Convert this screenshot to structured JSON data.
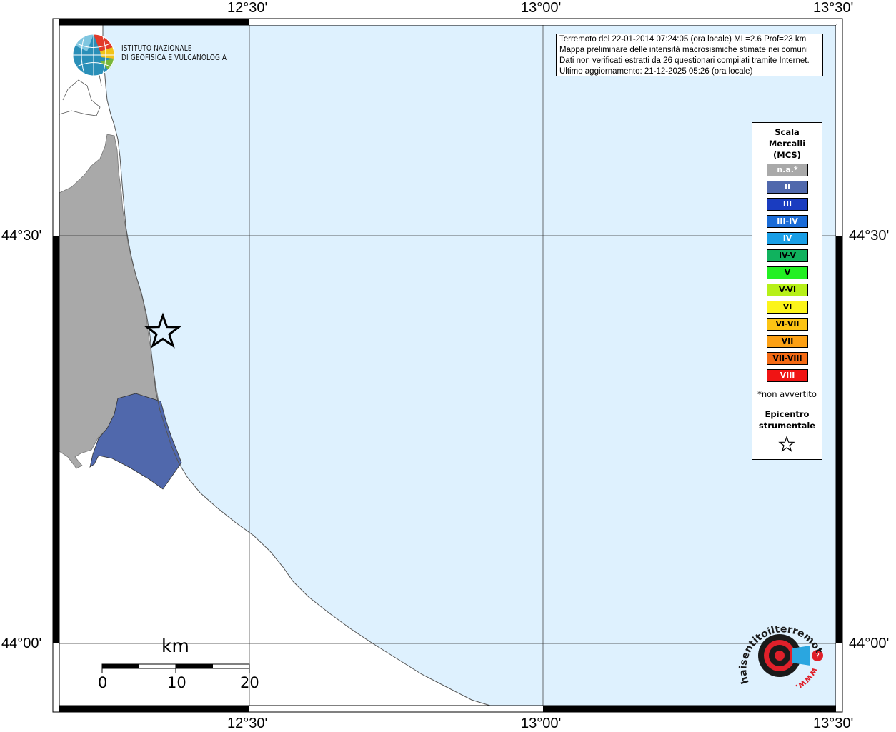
{
  "ticks": {
    "top": [
      "12°30'",
      "13°00'",
      "13°30'"
    ],
    "bottom": [
      "12°30'",
      "13°00'",
      "13°30'"
    ],
    "left": [
      "44°30'",
      "44°00'"
    ],
    "right": [
      "44°30'",
      "44°00'"
    ]
  },
  "info": {
    "line1": "Terremoto del 22-01-2014 07:24:05 (ora locale) ML=2.6 Prof=23 km",
    "line2": "Mappa preliminare delle intensità macrosismiche stimate nei comuni",
    "line3": "Dati non verificati estratti da 26 questionari compilati tramite Internet.",
    "line4": "Ultimo aggiornamento: 21-12-2025 05:26 (ora locale)"
  },
  "logo": {
    "line1": "ISTITUTO NAZIONALE",
    "line2": "DI GEOFISICA E VULCANOLOGIA"
  },
  "legend": {
    "title1": "Scala",
    "title2": "Mercalli",
    "title3": "(MCS)",
    "items": [
      {
        "label": "n.a.*",
        "color": "#a9a9a9"
      },
      {
        "label": "II",
        "color": "#5068ac"
      },
      {
        "label": "III",
        "color": "#1a3cc0"
      },
      {
        "label": "III-IV",
        "color": "#1a6cd8"
      },
      {
        "label": "IV",
        "color": "#189ee6"
      },
      {
        "label": "IV-V",
        "color": "#10b25e"
      },
      {
        "label": "V",
        "color": "#22f022"
      },
      {
        "label": "V-VI",
        "color": "#b6f018"
      },
      {
        "label": "VI",
        "color": "#fcf41a"
      },
      {
        "label": "VI-VII",
        "color": "#fcc414"
      },
      {
        "label": "VII",
        "color": "#fca014"
      },
      {
        "label": "VII-VIII",
        "color": "#f46a14"
      },
      {
        "label": "VIII",
        "color": "#f01414"
      }
    ],
    "note": "*non avvertito",
    "epi1": "Epicentro",
    "epi2": "strumentale"
  },
  "scale_bar": {
    "unit": "km",
    "labels": [
      "0",
      "10",
      "20"
    ]
  },
  "colors": {
    "sea": "#def1fe",
    "land": "#ffffff",
    "na_region": "#a9a9a9",
    "intensity_II": "#5068ac"
  },
  "watermark": {
    "text1": "haisentitoilterremoto.it",
    "text2": "www."
  }
}
